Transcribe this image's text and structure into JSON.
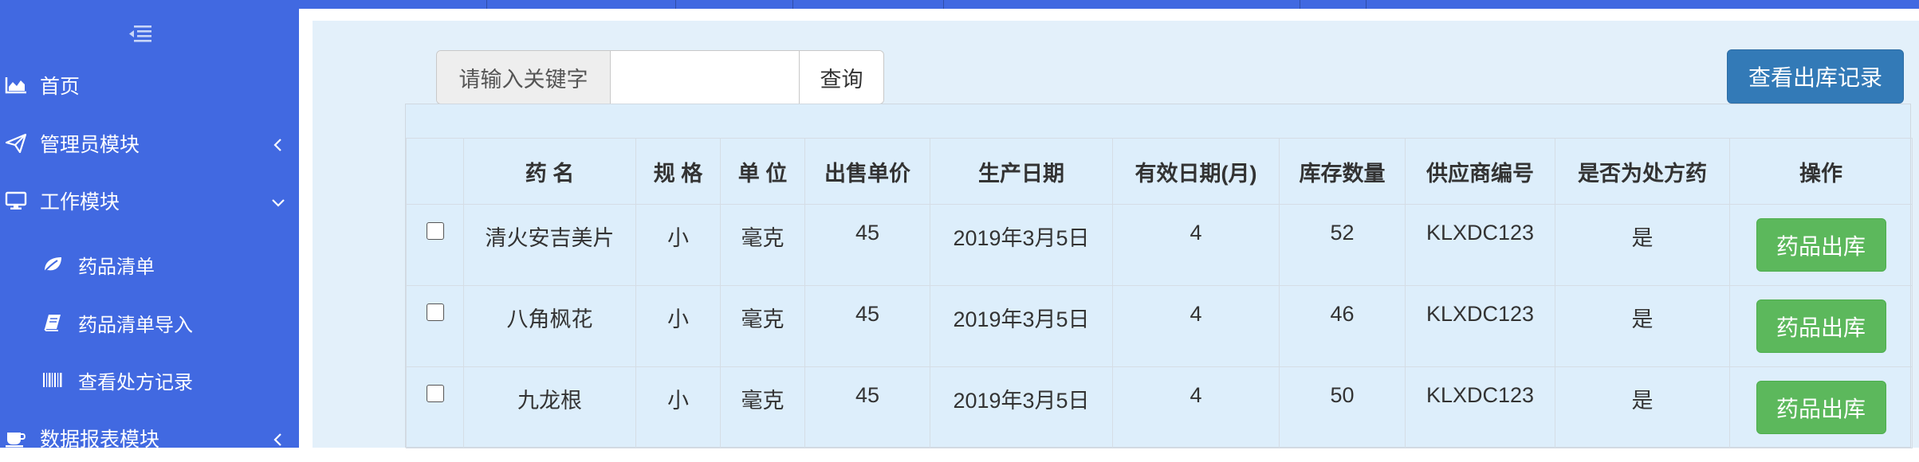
{
  "sidebar": {
    "items": [
      {
        "label": "首页",
        "icon": "area-chart-icon"
      },
      {
        "label": "管理员模块",
        "icon": "paper-plane-icon"
      },
      {
        "label": "工作模块",
        "icon": "desktop-icon"
      },
      {
        "label": "数据报表模块",
        "icon": "coffee-icon"
      }
    ],
    "sub_items": [
      {
        "label": "药品清单",
        "icon": "leaf-icon"
      },
      {
        "label": "药品清单导入",
        "icon": "book-icon"
      },
      {
        "label": "查看处方记录",
        "icon": "barcode-icon"
      }
    ]
  },
  "search": {
    "label": "请输入关键字",
    "value": "",
    "button": "查询"
  },
  "records_button": "查看出库记录",
  "table": {
    "headers": [
      "药 名",
      "规 格",
      "单 位",
      "出售单价",
      "生产日期",
      "有效日期(月)",
      "库存数量",
      "供应商编号",
      "是否为处方药",
      "操作"
    ],
    "rows": [
      {
        "name": "清火安吉美片",
        "spec": "小",
        "unit": "毫克",
        "price": "45",
        "date": "2019年3月5日",
        "valid": "4",
        "stock": "52",
        "supplier": "KLXDC123",
        "rx": "是",
        "action": "药品出库"
      },
      {
        "name": "八角枫花",
        "spec": "小",
        "unit": "毫克",
        "price": "45",
        "date": "2019年3月5日",
        "valid": "4",
        "stock": "46",
        "supplier": "KLXDC123",
        "rx": "是",
        "action": "药品出库"
      },
      {
        "name": "九龙根",
        "spec": "小",
        "unit": "毫克",
        "price": "45",
        "date": "2019年3月5日",
        "valid": "4",
        "stock": "50",
        "supplier": "KLXDC123",
        "rx": "是",
        "action": "药品出库"
      }
    ]
  },
  "colors": {
    "sidebar": "#4169e1",
    "main_bg": "#e3f0fa",
    "primary": "#337ab7",
    "success": "#5cb85c"
  }
}
